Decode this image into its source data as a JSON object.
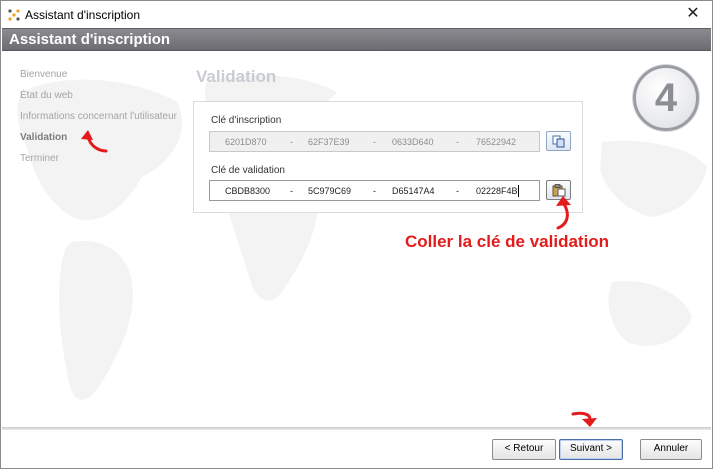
{
  "window": {
    "title": "Assistant d'inscription",
    "close_glyph": "✕"
  },
  "header": {
    "title": "Assistant d'inscription"
  },
  "sidebar": {
    "items": [
      {
        "label": "Bienvenue",
        "active": false
      },
      {
        "label": "État du web",
        "active": false
      },
      {
        "label": "Informations concernant l'utilisateur",
        "active": false
      },
      {
        "label": "Validation",
        "active": true
      },
      {
        "label": "Terminer",
        "active": false
      }
    ]
  },
  "step": {
    "title": "Validation",
    "number": "4"
  },
  "inscription": {
    "label": "Clé d'inscription",
    "separator": "-",
    "parts": [
      "6201D870",
      "62F37E39",
      "0633D640",
      "76522942"
    ],
    "copy_icon": "copy-icon"
  },
  "validation": {
    "label": "Clé de validation",
    "separator": "-",
    "parts": [
      "CBDB8300",
      "5C979C69",
      "D65147A4",
      "02228F4B"
    ],
    "paste_icon": "paste-icon"
  },
  "annotation": {
    "text": "Coller la clé de validation",
    "color": "#e31b1b"
  },
  "footer": {
    "back_label": "< Retour",
    "next_label": "Suivant >",
    "cancel_label": "Annuler"
  },
  "colors": {
    "header_band": "#77777d",
    "accent_red": "#e31b1b",
    "sidebar_text": "#a4a4a4",
    "sidebar_active": "#7d7d7d"
  }
}
